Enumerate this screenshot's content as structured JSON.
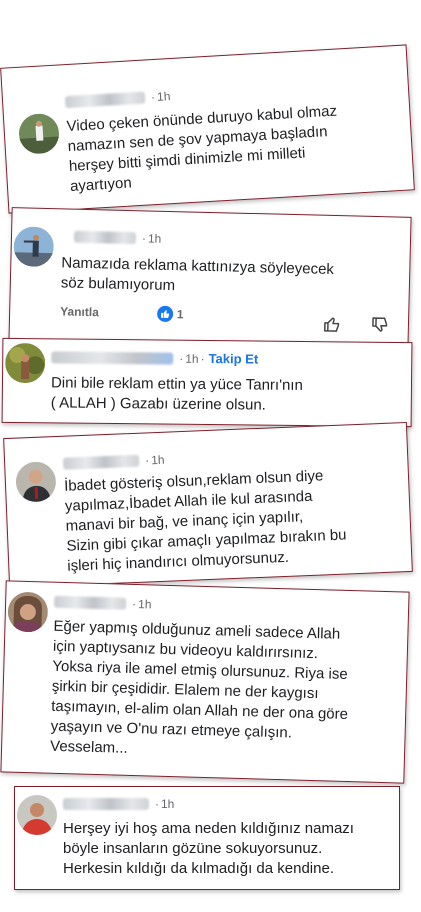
{
  "comments": [
    {
      "time": "1h",
      "lines": [
        "Video çeken önünde duruyo kabul olmaz",
        "namazın sen de şov yapmaya başladın",
        "herşey bitti şimdi dinimizle mi milleti",
        "ayartıyon"
      ]
    },
    {
      "time": "1h",
      "lines": [
        "Namazıda reklama kattınızya söyleyecek",
        "söz bulamıyorum"
      ],
      "reply_label": "Yanıtla",
      "like_count": "1"
    },
    {
      "time": "1h",
      "follow_label": "Takip Et",
      "lines": [
        "Dini bile reklam ettin ya yüce Tanrı'nın",
        "( ALLAH ) Gazabı üzerine olsun."
      ]
    },
    {
      "time": "1h",
      "lines": [
        "İbadet gösteriş olsun,reklam olsun diye",
        "yapılmaz,İbadet Allah ile kul arasında",
        "manavi bir bağ, ve inanç için yapılır,",
        "Sizin gibi çıkar amaçlı yapılmaz bırakın bu",
        "işleri hiç inandırıcı olmuyorsunuz."
      ]
    },
    {
      "time": "1h",
      "lines": [
        "Eğer yapmış olduğunuz ameli sadece Allah",
        "için yaptıysanız bu videoyu kaldırırsınız.",
        "Yoksa riya ile amel etmiş olursunuz. Riya ise",
        "şirkin bir çeşididir. Elalem ne der kaygısı",
        "taşımayın, el-alim olan Allah ne der ona göre",
        "yaşayın ve O'nu razı etmeye çalışın.",
        "Vesselam..."
      ]
    },
    {
      "time": "1h",
      "lines": [
        "Herşey iyi hoş ama neden kıldığınız namazı",
        "böyle insanların gözüne sokuyorsunuz.",
        "Herkesin kıldığı da kılmadığı da kendine."
      ]
    }
  ],
  "colors": {
    "card_border": "#7a1f2b",
    "follow": "#1b74e4",
    "like_badge": "#1877f2",
    "text": "#1c1e21",
    "meta": "#65676b"
  },
  "icons": [
    "thumbs-up-outline-icon",
    "thumbs-down-outline-icon",
    "like-badge-icon"
  ]
}
